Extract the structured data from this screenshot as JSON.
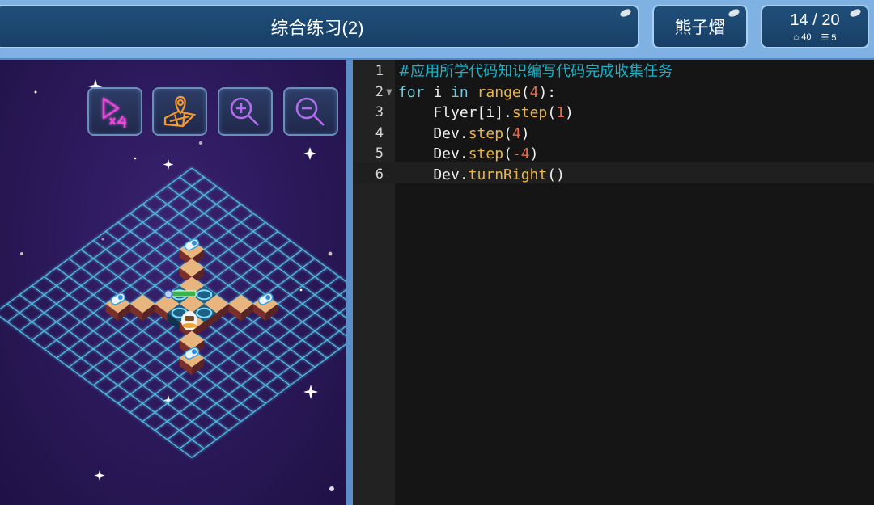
{
  "header": {
    "title": "综合练习(2)",
    "user": "熊子熠",
    "progress": "14 / 20",
    "stat_steps": "40",
    "stat_lines": "5"
  },
  "toolbar": {
    "speed_button": "x4-speed-icon",
    "map_button": "map-pin-icon",
    "zoom_in": "zoom-in-icon",
    "zoom_out": "zoom-out-icon"
  },
  "editor": {
    "line_numbers": [
      "1",
      "2",
      "3",
      "4",
      "5",
      "6"
    ],
    "lines": [
      [
        {
          "t": "#应用所学代码知识编写代码完成收集任务",
          "c": "c-comment"
        }
      ],
      [
        {
          "t": "for",
          "c": "c-kw"
        },
        {
          "t": " i ",
          "c": "c-plain"
        },
        {
          "t": "in",
          "c": "c-kw"
        },
        {
          "t": " ",
          "c": "c-plain"
        },
        {
          "t": "range",
          "c": "c-fn"
        },
        {
          "t": "(",
          "c": "c-op"
        },
        {
          "t": "4",
          "c": "c-num"
        },
        {
          "t": "):",
          "c": "c-op"
        }
      ],
      [
        {
          "t": "    Flyer[i].",
          "c": "c-plain"
        },
        {
          "t": "step",
          "c": "c-fn"
        },
        {
          "t": "(",
          "c": "c-op"
        },
        {
          "t": "1",
          "c": "c-num"
        },
        {
          "t": ")",
          "c": "c-op"
        }
      ],
      [
        {
          "t": "    Dev.",
          "c": "c-plain"
        },
        {
          "t": "step",
          "c": "c-fn"
        },
        {
          "t": "(",
          "c": "c-op"
        },
        {
          "t": "4",
          "c": "c-num"
        },
        {
          "t": ")",
          "c": "c-op"
        }
      ],
      [
        {
          "t": "    Dev.",
          "c": "c-plain"
        },
        {
          "t": "step",
          "c": "c-fn"
        },
        {
          "t": "(",
          "c": "c-op"
        },
        {
          "t": "-4",
          "c": "c-num"
        },
        {
          "t": ")",
          "c": "c-op"
        }
      ],
      [
        {
          "t": "    Dev.",
          "c": "c-plain"
        },
        {
          "t": "turnRight",
          "c": "c-fn"
        },
        {
          "t": "(",
          "c": "c-op"
        },
        {
          "t": ")",
          "c": "c-op"
        }
      ]
    ]
  },
  "colors": {
    "grid": "#52c2e6",
    "tile": "#e9b57f",
    "tile_side": "#7a2f2a",
    "target": "#1d5f86",
    "neon_pink": "#e84ad8",
    "neon_orange": "#f29a2e",
    "neon_purple": "#b56cf0"
  }
}
